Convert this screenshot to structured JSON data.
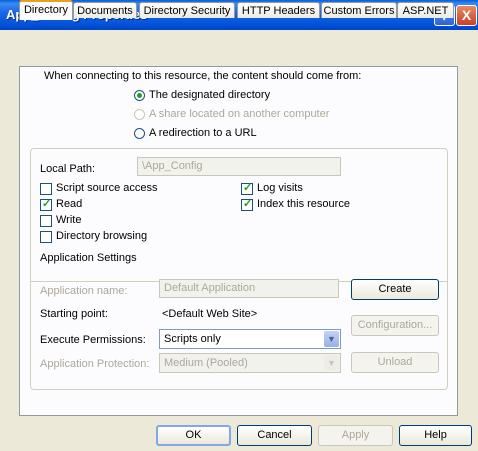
{
  "window": {
    "title": "App_Config Properties",
    "help_button": "?",
    "close_button": "X"
  },
  "tabs": [
    "Directory",
    "Documents",
    "Directory Security",
    "HTTP Headers",
    "Custom Errors",
    "ASP.NET"
  ],
  "content_source": {
    "prompt": "When connecting to this resource, the content should come from:",
    "options": [
      "The designated directory",
      "A share located on another computer",
      "A redirection to a URL"
    ],
    "selected": "The designated directory"
  },
  "local_path": {
    "label": "Local Path:",
    "value": "\\App_Config"
  },
  "checkboxes": {
    "script_source_access": {
      "label": "Script source access",
      "checked": false
    },
    "read": {
      "label": "Read",
      "checked": true
    },
    "write": {
      "label": "Write",
      "checked": false
    },
    "directory_browsing": {
      "label": "Directory browsing",
      "checked": false
    },
    "log_visits": {
      "label": "Log visits",
      "checked": true
    },
    "index_resource": {
      "label": "Index this resource",
      "checked": true
    }
  },
  "app_settings": {
    "heading": "Application Settings",
    "app_name_label": "Application name:",
    "app_name_value": "Default Application",
    "starting_point_label": "Starting point:",
    "starting_point_value": "<Default Web Site>",
    "exec_perm_label": "Execute Permissions:",
    "exec_perm_value": "Scripts only",
    "app_protection_label": "Application Protection:",
    "app_protection_value": "Medium (Pooled)",
    "create_button": "Create",
    "configuration_button": "Configuration...",
    "unload_button": "Unload"
  },
  "footer": {
    "ok": "OK",
    "cancel": "Cancel",
    "apply": "Apply",
    "help": "Help"
  }
}
